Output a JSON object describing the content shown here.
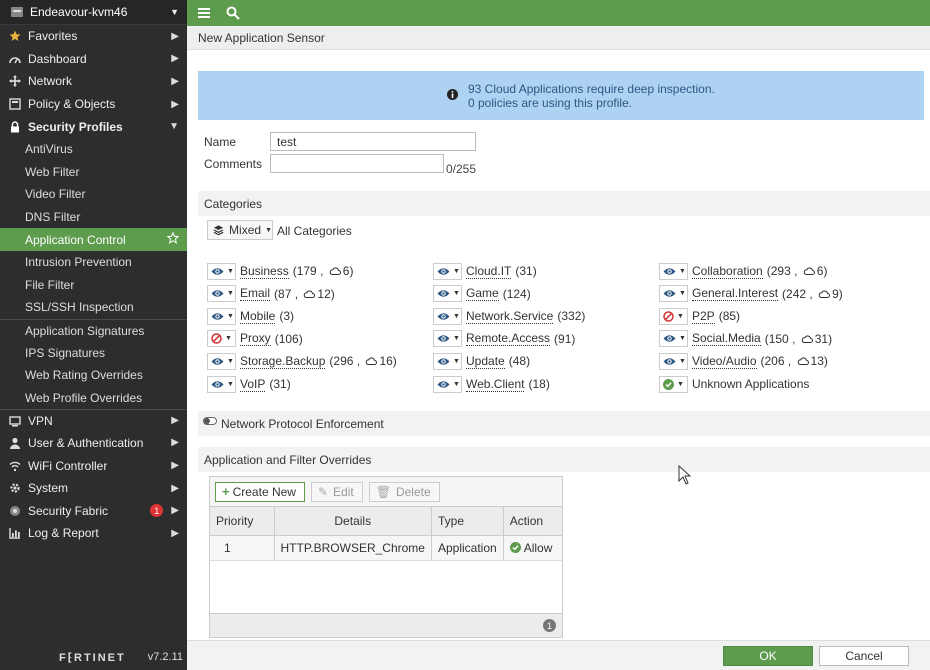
{
  "device": {
    "name": "Endeavour-kvm46"
  },
  "sidebar": {
    "items": [
      {
        "label": "Favorites",
        "icon": "star-icon",
        "chevron": true
      },
      {
        "label": "Dashboard",
        "icon": "dashboard-icon",
        "chevron": true
      },
      {
        "label": "Network",
        "icon": "network-icon",
        "chevron": true
      },
      {
        "label": "Policy & Objects",
        "icon": "policy-icon",
        "chevron": true
      },
      {
        "label": "Security Profiles",
        "icon": "lock-icon",
        "chevron": true,
        "open": true
      }
    ],
    "sub_items_1": [
      "AntiVirus",
      "Web Filter",
      "Video Filter",
      "DNS Filter",
      "Application Control",
      "Intrusion Prevention",
      "File Filter",
      "SSL/SSH Inspection"
    ],
    "sub_items_2": [
      "Application Signatures",
      "IPS Signatures",
      "Web Rating Overrides",
      "Web Profile Overrides"
    ],
    "active_sub": "Application Control",
    "items_after": [
      {
        "label": "VPN",
        "icon": "vpn-icon"
      },
      {
        "label": "User & Authentication",
        "icon": "user-icon"
      },
      {
        "label": "WiFi Controller",
        "icon": "wifi-icon"
      },
      {
        "label": "System",
        "icon": "gear-icon"
      },
      {
        "label": "Security Fabric",
        "icon": "fabric-icon",
        "badge": "1"
      },
      {
        "label": "Log & Report",
        "icon": "chart-icon"
      }
    ],
    "footer": {
      "logo": "F⁅RTINET",
      "version": "v7.2.11"
    }
  },
  "page": {
    "title": "New Application Sensor"
  },
  "info": {
    "line1": "93 Cloud Applications require deep inspection.",
    "line2": "0 policies are using this profile."
  },
  "form": {
    "name_label": "Name",
    "name_value": "test",
    "comments_label": "Comments",
    "comments_value": "",
    "comments_counter": "0/255"
  },
  "categories": {
    "section_title": "Categories",
    "mixed_label": "Mixed",
    "all_label": "All Categories",
    "items": [
      {
        "name": "Business",
        "count": "179",
        "cloud": "6",
        "action": "monitor"
      },
      {
        "name": "Cloud.IT",
        "count": "31",
        "action": "monitor"
      },
      {
        "name": "Collaboration",
        "count": "293",
        "cloud": "6",
        "action": "monitor"
      },
      {
        "name": "Email",
        "count": "87",
        "cloud": "12",
        "action": "monitor"
      },
      {
        "name": "Game",
        "count": "124",
        "action": "monitor"
      },
      {
        "name": "General.Interest",
        "count": "242",
        "cloud": "9",
        "action": "monitor"
      },
      {
        "name": "Mobile",
        "count": "3",
        "action": "monitor"
      },
      {
        "name": "Network.Service",
        "count": "332",
        "action": "monitor"
      },
      {
        "name": "P2P",
        "count": "85",
        "action": "block"
      },
      {
        "name": "Proxy",
        "count": "106",
        "action": "block"
      },
      {
        "name": "Remote.Access",
        "count": "91",
        "action": "monitor"
      },
      {
        "name": "Social.Media",
        "count": "150",
        "cloud": "31",
        "action": "monitor"
      },
      {
        "name": "Storage.Backup",
        "count": "296",
        "cloud": "16",
        "action": "monitor"
      },
      {
        "name": "Update",
        "count": "48",
        "action": "monitor"
      },
      {
        "name": "Video/Audio",
        "count": "206",
        "cloud": "13",
        "action": "monitor"
      },
      {
        "name": "VoIP",
        "count": "31",
        "action": "monitor"
      },
      {
        "name": "Web.Client",
        "count": "18",
        "action": "monitor"
      },
      {
        "name": "Unknown Applications",
        "action": "allow"
      }
    ]
  },
  "npe": {
    "label": "Network Protocol Enforcement"
  },
  "overrides": {
    "section_title": "Application and Filter Overrides",
    "create_label": "Create New",
    "edit_label": "Edit",
    "delete_label": "Delete",
    "columns": [
      "Priority",
      "Details",
      "Type",
      "Action"
    ],
    "rows": [
      {
        "priority": "1",
        "details": "HTTP.BROWSER_Chrome",
        "type": "Application",
        "action": "Allow"
      }
    ],
    "page_count": "1"
  },
  "footer": {
    "ok_label": "OK",
    "cancel_label": "Cancel"
  },
  "colors": {
    "accent": "#5d9b4d",
    "sidebar": "#2d2d2d",
    "info_bg": "#aed3f2",
    "block": "#d33333"
  }
}
